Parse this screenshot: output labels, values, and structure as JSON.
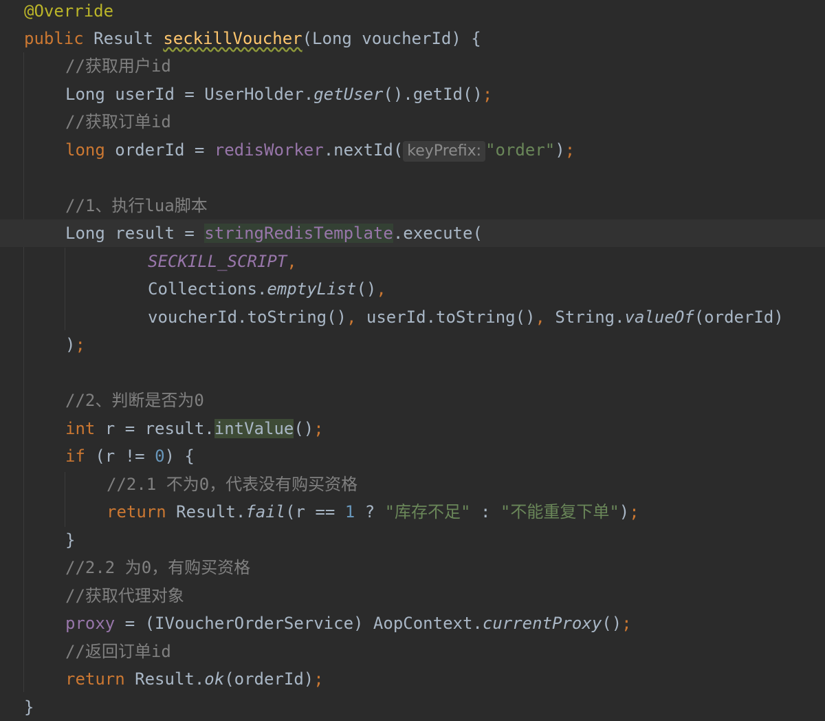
{
  "editor": {
    "lines": [
      {
        "annotation": "@Override"
      },
      {
        "kw_public": "public",
        "type": "Result",
        "method": "seckillVoucher",
        "params": "(Long voucherId) {"
      },
      {
        "comment": "//获取用户id"
      },
      {
        "type": "Long",
        "rest1": " userId = UserHolder.",
        "call": "getUser",
        "rest2": "().getId()",
        "semi": ";"
      },
      {
        "comment": "//获取订单id"
      },
      {
        "kw": "long",
        "rest1": " orderId = ",
        "field": "redisWorker",
        "rest2": ".nextId(",
        "hint": "keyPrefix:",
        "str": "\"order\"",
        "rest3": ")",
        "semi": ";"
      },
      {
        "comment": "//1、执行lua脚本"
      },
      {
        "type": "Long",
        "rest1": " result = ",
        "field": "stringRedisTemplate",
        "rest2": ".execute("
      },
      {
        "static": "SECKILL_SCRIPT",
        "comma": ","
      },
      {
        "rest1": "Collections.",
        "call": "emptyList",
        "rest2": "()",
        "comma": ","
      },
      {
        "a": "voucherId.toString()",
        "c1": ",",
        "b": " userId.toString()",
        "c2": ",",
        "c": " String.",
        "call": "valueOf",
        "d": "(orderId)"
      },
      {
        "rest1": ")",
        "semi": ";"
      },
      {
        "comment": "//2、判断是否为0"
      },
      {
        "kw": "int",
        "rest1": " r = result.",
        "method": "intValue",
        "rest2": "()",
        "semi": ";"
      },
      {
        "kw": "if",
        "rest1": " (r != ",
        "num": "0",
        "rest2": ") {"
      },
      {
        "comment": "//2.1 不为0，代表没有购买资格"
      },
      {
        "kw": "return",
        "rest1": " Result.",
        "call": "fail",
        "rest2": "(r == ",
        "num": "1",
        "rest3": " ? ",
        "str1": "\"库存不足\"",
        "rest4": " : ",
        "str2": "\"不能重复下单\"",
        "rest5": ")",
        "semi": ";"
      },
      {
        "rest1": "}"
      },
      {
        "comment": "//2.2 为0，有购买资格"
      },
      {
        "comment2": "//获取代理对象"
      },
      {
        "field": "proxy",
        "rest1": " = (IVoucherOrderService) AopContext.",
        "call": "currentProxy",
        "rest2": "()",
        "semi": ";"
      },
      {
        "comment": "//返回订单id"
      },
      {
        "kw": "return",
        "rest1": " Result.",
        "call": "ok",
        "rest2": "(orderId)",
        "semi": ";"
      },
      {
        "rest1": "}"
      }
    ]
  }
}
